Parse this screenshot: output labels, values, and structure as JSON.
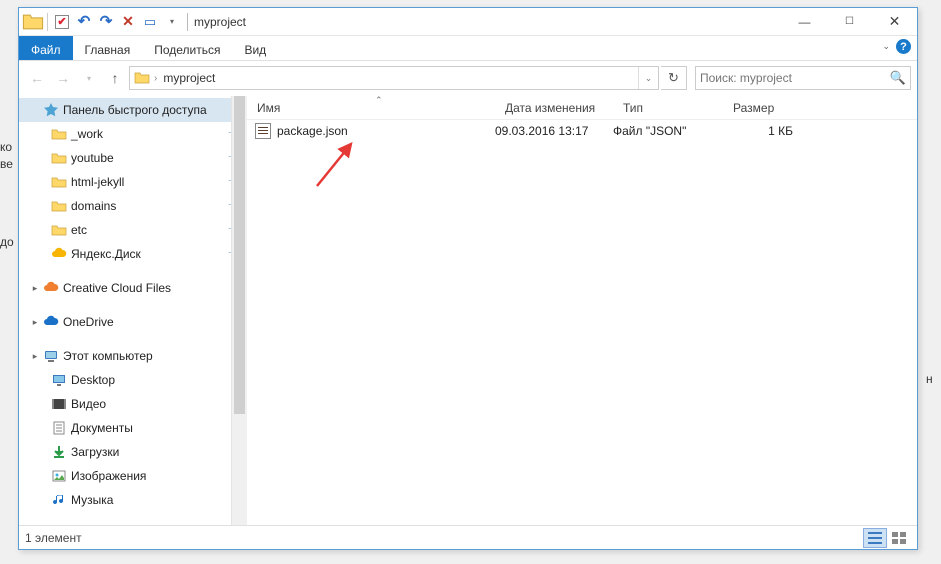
{
  "title": "myproject",
  "ribbon": {
    "file": "Файл",
    "home": "Главная",
    "share": "Поделиться",
    "view": "Вид"
  },
  "nav": {
    "crumb": "myproject",
    "search_placeholder": "Поиск: myproject"
  },
  "sidebar": {
    "quick_access": "Панель быстрого доступа",
    "pinned": [
      {
        "label": "_work"
      },
      {
        "label": "youtube"
      },
      {
        "label": "html-jekyll"
      },
      {
        "label": "domains"
      },
      {
        "label": "etc"
      },
      {
        "label": "Яндекс.Диск",
        "cloud": true
      }
    ],
    "cc": "Creative Cloud Files",
    "onedrive": "OneDrive",
    "thispc": "Этот компьютер",
    "pc_children": [
      {
        "label": "Desktop",
        "icon": "desktop"
      },
      {
        "label": "Видео",
        "icon": "video"
      },
      {
        "label": "Документы",
        "icon": "doc"
      },
      {
        "label": "Загрузки",
        "icon": "download"
      },
      {
        "label": "Изображения",
        "icon": "image"
      },
      {
        "label": "Музыка",
        "icon": "music"
      }
    ]
  },
  "columns": {
    "name": "Имя",
    "date": "Дата изменения",
    "type": "Тип",
    "size": "Размер"
  },
  "files": [
    {
      "name": "package.json",
      "date": "09.03.2016 13:17",
      "type": "Файл \"JSON\"",
      "size": "1 КБ"
    }
  ],
  "status": "1 элемент"
}
